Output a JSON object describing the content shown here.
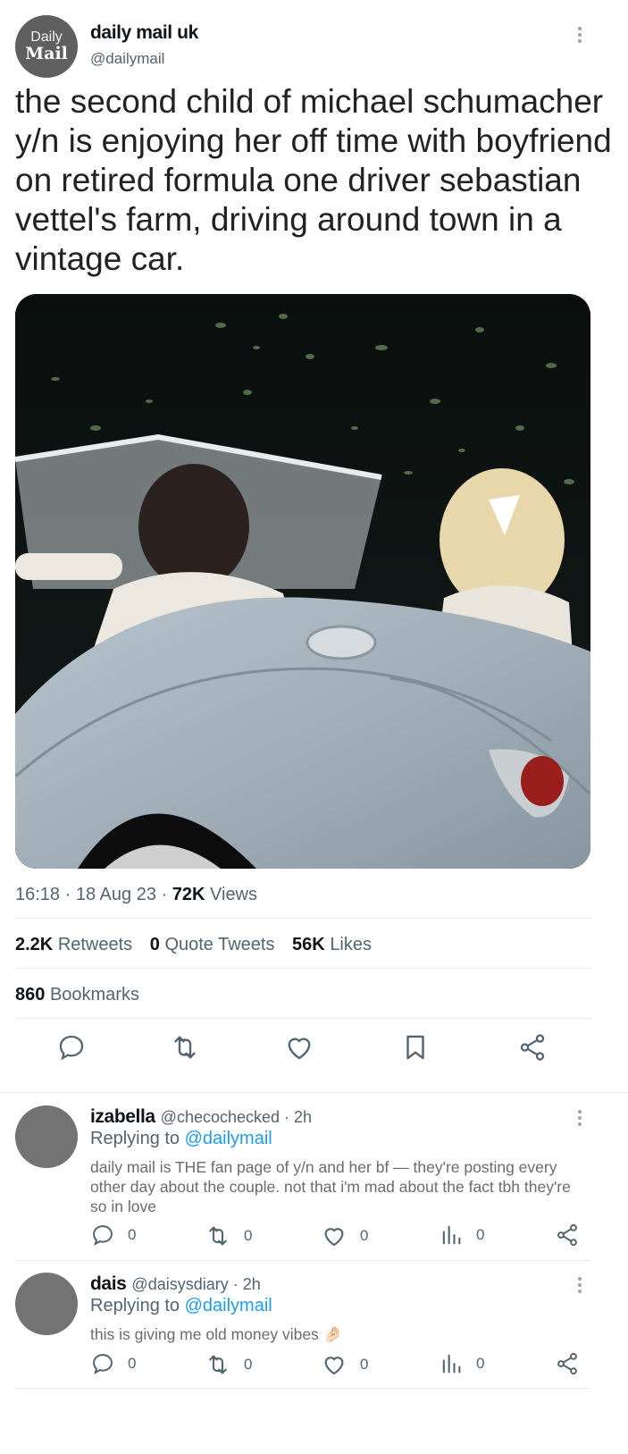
{
  "author": {
    "logo_top": "Daily",
    "logo_bottom": "Mail",
    "name": "daily mail uk",
    "handle": "@dailymail"
  },
  "tweet": {
    "text": "the second child of michael schumacher y/n is enjoying her off time with boyfriend on retired formula one driver sebastian vettel's farm, driving around town in a vintage car.",
    "time": "16:18",
    "date": "18 Aug 23",
    "sep": "·",
    "views_count": "72K",
    "views_label": "Views",
    "retweets_count": "2.2K",
    "retweets_label": "Retweets",
    "quotes_count": "0",
    "quotes_label": "Quote Tweets",
    "likes_count": "56K",
    "likes_label": "Likes",
    "bookmarks_count": "860",
    "bookmarks_label": "Bookmarks"
  },
  "action_icons": [
    "reply-icon",
    "retweet-icon",
    "like-icon",
    "bookmark-icon",
    "share-icon"
  ],
  "colors": {
    "link": "#1d9bf0",
    "muted": "#536471",
    "icon": "#536471"
  },
  "replies": [
    {
      "name": "izabella",
      "handle": "@checochecked · 2h",
      "replying_label": "Replying to",
      "replying_to": "@dailymail",
      "text": "daily mail is THE fan page of y/n and her bf — they're posting every other day about the couple. not that i'm mad about the fact tbh they're so in love",
      "reply_count": "0",
      "retweet_count": "0",
      "like_count": "0",
      "views_count": "0"
    },
    {
      "name": "dais",
      "handle": "@daisysdiary · 2h",
      "replying_label": "Replying to",
      "replying_to": "@dailymail",
      "text": "this is giving me old money vibes 🤌🏻",
      "reply_count": "0",
      "retweet_count": "0",
      "like_count": "0",
      "views_count": "0"
    }
  ]
}
